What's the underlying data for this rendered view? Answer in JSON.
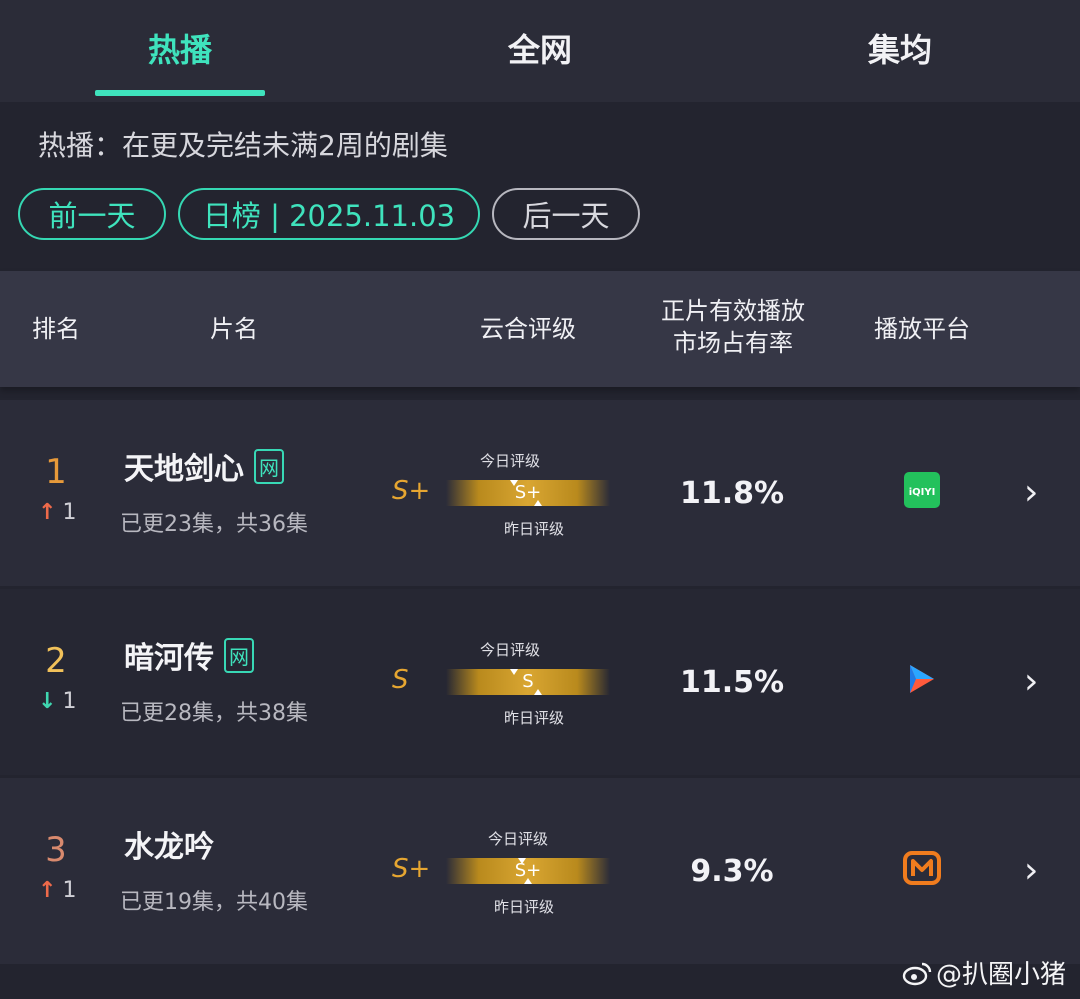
{
  "tabs": [
    {
      "label": "热播",
      "active": true
    },
    {
      "label": "全网",
      "active": false
    },
    {
      "label": "集均",
      "active": false
    }
  ],
  "description": "热播：在更及完结未满2周的剧集",
  "date_nav": {
    "prev": "前一天",
    "current": "日榜 | 2025.11.03",
    "next": "后一天"
  },
  "table_header": {
    "rank": "排名",
    "title": "片名",
    "rating": "云合评级",
    "share_line1": "正片有效播放",
    "share_line2": "市场占有率",
    "platform": "播放平台"
  },
  "grade_labels": {
    "today": "今日评级",
    "yesterday": "昨日评级"
  },
  "rows": [
    {
      "rank": "1",
      "rank_color": "#e79a3a",
      "change_dir": "up",
      "change": "1",
      "title": "天地剑心",
      "badge": "网",
      "episodes": "已更23集，共36集",
      "grade": "S+",
      "grade_bar": "S+",
      "share": "11.8%",
      "platform": "iqiyi-icon",
      "platform_text": "iQIYI"
    },
    {
      "rank": "2",
      "rank_color": "#f1c15a",
      "change_dir": "down",
      "change": "1",
      "title": "暗河传",
      "badge": "网",
      "episodes": "已更28集，共38集",
      "grade": "S",
      "grade_bar": "S",
      "share": "11.5%",
      "platform": "youku-icon",
      "platform_text": ""
    },
    {
      "rank": "3",
      "rank_color": "#d98a6e",
      "change_dir": "up",
      "change": "1",
      "title": "水龙吟",
      "badge": "",
      "episodes": "已更19集，共40集",
      "grade": "S+",
      "grade_bar": "S+",
      "share": "9.3%",
      "platform": "mango-tv-icon",
      "platform_text": ""
    }
  ],
  "watermark": "@扒圈小猪",
  "colors": {
    "accent": "#3fe3bd",
    "up_arrow": "#ee6a4a",
    "down_arrow": "#3fd6b0",
    "grade": "#e6a631"
  }
}
